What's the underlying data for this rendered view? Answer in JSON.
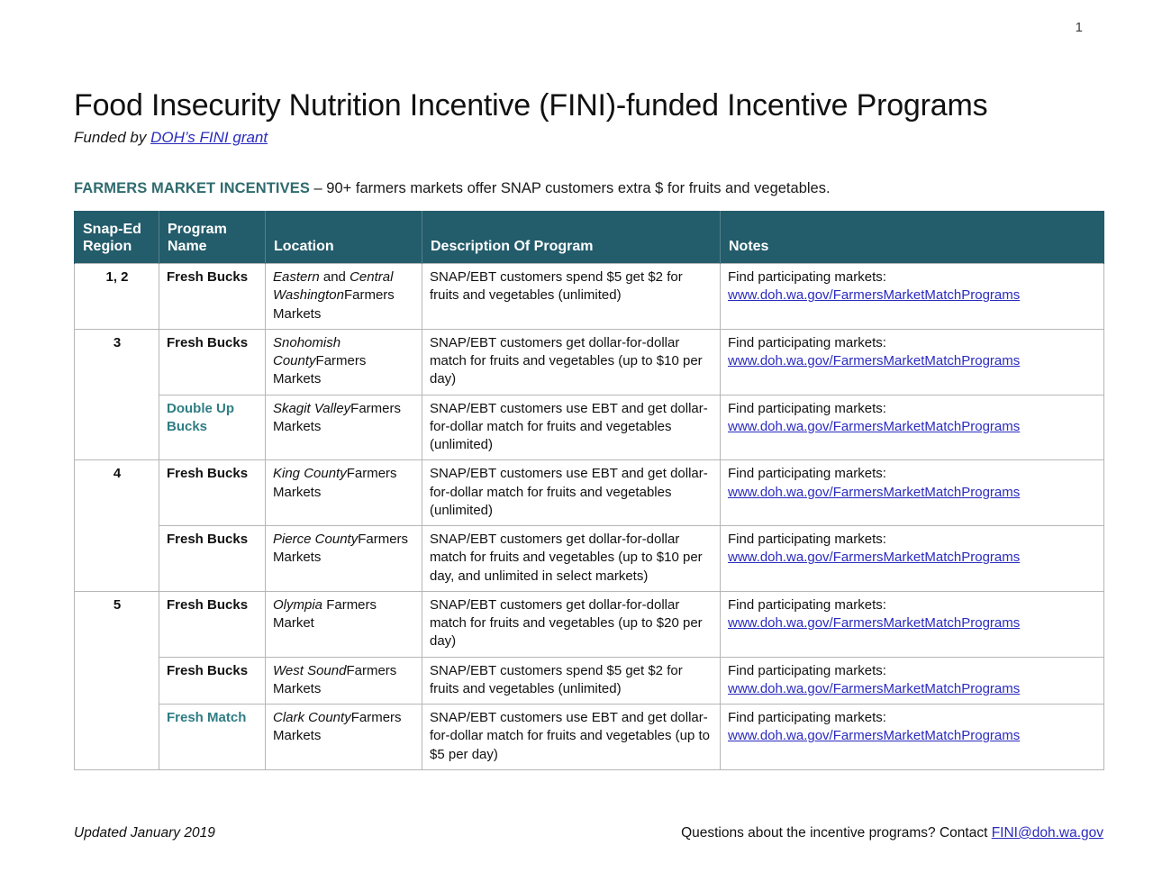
{
  "page": {
    "number": "1"
  },
  "header": {
    "title": "Food Insecurity Nutrition Incentive (FINI)-funded Incentive Programs",
    "funded_prefix": "Funded by ",
    "funded_link": "DOH’s FINI grant"
  },
  "section": {
    "heading": "FARMERS MARKET INCENTIVES",
    "heading_rest": " – 90+ farmers markets offer SNAP customers extra $ for fruits and vegetables."
  },
  "table": {
    "columns": [
      "Snap-Ed Region",
      "Program Name",
      "Location",
      "Description Of Program",
      "Notes"
    ],
    "columns_display": {
      "region_line1": "Snap-Ed",
      "region_line2": "Region",
      "program_line1": "Program",
      "program_line2": "Name",
      "location": "Location",
      "description": "Description Of Program",
      "notes": "Notes"
    },
    "notes_label": "Find participating markets:",
    "notes_link": "www.doh.wa.gov/FarmersMarketMatchPrograms",
    "groups": [
      {
        "region": "1, 2",
        "rows": [
          {
            "program": "Fresh Bucks",
            "program_accent": false,
            "location_italic": "Eastern",
            "location_mid": " and ",
            "location_italic2": "Central Washington",
            "location_rest": "Farmers Markets",
            "description": "SNAP/EBT customers spend $5 get $2 for fruits and vegetables (unlimited)"
          }
        ]
      },
      {
        "region": "3",
        "rows": [
          {
            "program": "Fresh Bucks",
            "program_accent": false,
            "location_italic": "Snohomish County",
            "location_mid": "",
            "location_italic2": "",
            "location_rest": "Farmers Markets",
            "description": "SNAP/EBT customers get dollar-for-dollar match for fruits and vegetables (up to $10 per day)"
          },
          {
            "program": "Double Up Bucks",
            "program_accent": true,
            "location_italic": "Skagit Valley",
            "location_mid": "",
            "location_italic2": "",
            "location_rest": "Farmers Markets",
            "description": "SNAP/EBT customers use EBT and get dollar-for-dollar match for fruits and vegetables (unlimited)"
          }
        ]
      },
      {
        "region": "4",
        "rows": [
          {
            "program": "Fresh Bucks",
            "program_accent": false,
            "location_italic": "King County",
            "location_mid": "",
            "location_italic2": "",
            "location_rest": "Farmers Markets",
            "description": "SNAP/EBT customers use EBT and get dollar-for-dollar match for fruits and vegetables (unlimited)"
          },
          {
            "program": "Fresh Bucks",
            "program_accent": false,
            "location_italic": "Pierce County",
            "location_mid": "",
            "location_italic2": "",
            "location_rest": "Farmers Markets",
            "description": "SNAP/EBT customers get dollar-for-dollar match for fruits and vegetables (up to $10 per day, and unlimited in select markets)"
          }
        ]
      },
      {
        "region": "5",
        "rows": [
          {
            "program": "Fresh Bucks",
            "program_accent": false,
            "location_italic": "Olympia",
            "location_mid": " ",
            "location_italic2": "",
            "location_rest": "Farmers Market",
            "description": "SNAP/EBT customers get dollar-for-dollar match for fruits and vegetables (up to $20 per day)"
          },
          {
            "program": "Fresh Bucks",
            "program_accent": false,
            "location_italic": "West Sound",
            "location_mid": "",
            "location_italic2": "",
            "location_rest": "Farmers Markets",
            "description": "SNAP/EBT customers spend $5 get $2 for fruits and vegetables (unlimited)"
          },
          {
            "program": "Fresh Match",
            "program_accent": true,
            "location_italic": "Clark County",
            "location_mid": "",
            "location_italic2": "",
            "location_rest": "Farmers Markets",
            "description": "SNAP/EBT customers use EBT and get dollar-for-dollar match for fruits and vegetables (up to $5 per day)"
          }
        ]
      }
    ]
  },
  "footer": {
    "updated": "Updated January 2019",
    "contact_prefix": "Questions about the incentive programs? Contact ",
    "contact_link": "FINI@doh.wa.gov"
  },
  "colors": {
    "table_header_bg": "#235c6b",
    "accent_teal": "#2f7d84",
    "section_heading": "#2f6b6e",
    "link_blue": "#2b2bbf",
    "border_gray": "#b6b6b6"
  }
}
